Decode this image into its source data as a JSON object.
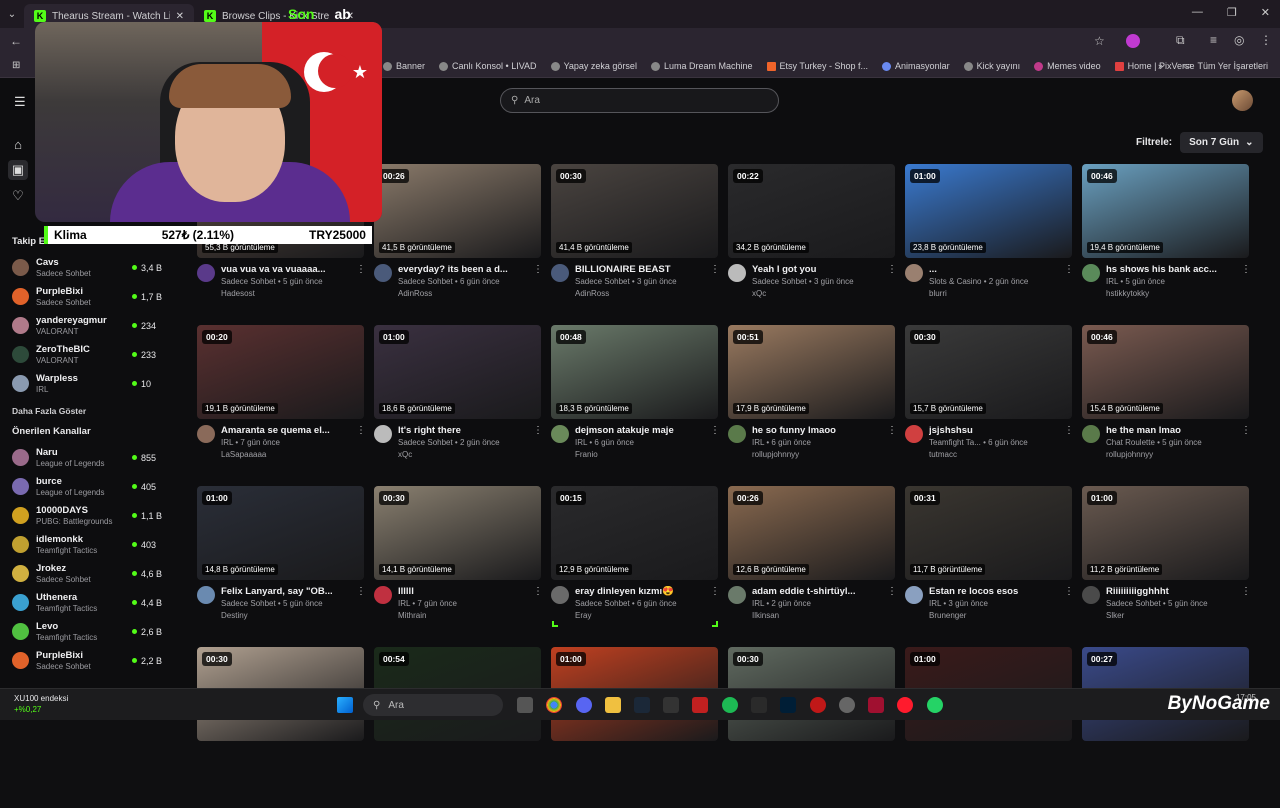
{
  "browser": {
    "tabs": [
      {
        "title": "Thearus Stream - Watch Live on",
        "active": true
      },
      {
        "title": "Browse Clips - Kick Stre",
        "active": false
      }
    ],
    "watermark": "Son",
    "watermark_tail": "ab",
    "bookmarks": [
      "Banner",
      "Canlı Konsol • LIVAD",
      "Yapay zeka görsel",
      "Luma Dream Machine",
      "Etsy Turkey - Shop f...",
      "Animasyonlar",
      "Kick yayını",
      "Memes video",
      "Home | PixVerse"
    ],
    "bookmarks_more": "»",
    "all_bookmarks": "Tüm Yer İşaretleri"
  },
  "search": {
    "placeholder": "Ara"
  },
  "filter": {
    "label": "Filtrele:",
    "value": "Son 7 Gün"
  },
  "overlay": {
    "ticker_name": "Klima",
    "ticker_value": "527₺ (2.11%)",
    "ticker_target": "TRY25000"
  },
  "sidebar": {
    "following_heading": "Takip E",
    "following": [
      {
        "name": "Cavs",
        "category": "Sadece Sohbet",
        "viewers": "3,4 B",
        "color": "#7a5a4a"
      },
      {
        "name": "PurpleBixi",
        "category": "Sadece Sohbet",
        "viewers": "1,7 B",
        "color": "#e0622a"
      },
      {
        "name": "yandereyagmur",
        "category": "VALORANT",
        "viewers": "234",
        "color": "#b07a8a"
      },
      {
        "name": "ZeroTheBIC",
        "category": "VALORANT",
        "viewers": "233",
        "color": "#2d4a3a"
      },
      {
        "name": "Warpless",
        "category": "IRL",
        "viewers": "10",
        "color": "#8a9ab0"
      }
    ],
    "show_more": "Daha Fazla Göster",
    "recommended_heading": "Önerilen Kanallar",
    "recommended": [
      {
        "name": "Naru",
        "category": "League of Legends",
        "viewers": "855",
        "color": "#9a6a8a"
      },
      {
        "name": "burce",
        "category": "League of Legends",
        "viewers": "405",
        "color": "#7a6ab0"
      },
      {
        "name": "10000DAYS",
        "category": "PUBG: Battlegrounds",
        "viewers": "1,1 B",
        "color": "#d0a020"
      },
      {
        "name": "idlemonkk",
        "category": "Teamfight Tactics",
        "viewers": "403",
        "color": "#c0a030"
      },
      {
        "name": "Jrokez",
        "category": "Sadece Sohbet",
        "viewers": "4,6 B",
        "color": "#d0b040"
      },
      {
        "name": "Uthenera",
        "category": "Teamfight Tactics",
        "viewers": "4,4 B",
        "color": "#3aa0d0"
      },
      {
        "name": "Levo",
        "category": "Teamfight Tactics",
        "viewers": "2,6 B",
        "color": "#50c040"
      },
      {
        "name": "PurpleBixi",
        "category": "Sadece Sohbet",
        "viewers": "2,2 B",
        "color": "#e0622a"
      }
    ]
  },
  "clips": [
    [
      {
        "duration": "00:26",
        "views": "55,3 B görüntüleme",
        "title": "vua vua va va vuaaaa...",
        "sub": "Sadece Sohbet • 5 gün önce",
        "channel": "Hadesost",
        "bg": "#5a4a40",
        "av": "#5a3a8a"
      },
      {
        "duration": "00:26",
        "views": "41,5 B görüntüleme",
        "title": "everyday? its been a d...",
        "sub": "Sadece Sohbet • 6 gün önce",
        "channel": "AdinRoss",
        "bg": "#8a7a6a",
        "av": "#4a5a7a"
      },
      {
        "duration": "00:30",
        "views": "41,4 B görüntüleme",
        "title": "BILLIONAIRE BEAST",
        "sub": "Sadece Sohbet • 3 gün önce",
        "channel": "AdinRoss",
        "bg": "#4a4440",
        "av": "#4a5a7a"
      },
      {
        "duration": "00:22",
        "views": "34,2 B görüntüleme",
        "title": "Yeah I got you",
        "sub": "Sadece Sohbet • 3 gün önce",
        "channel": "xQc",
        "bg": "#2a2a2c",
        "av": "#bbbbbb"
      },
      {
        "duration": "01:00",
        "views": "23,8 B görüntüleme",
        "title": "...",
        "sub": "Slots & Casino • 2 gün önce",
        "channel": "blurri",
        "bg": "#3a7ad0",
        "av": "#9a8070"
      },
      {
        "duration": "00:46",
        "views": "19,4 B görüntüleme",
        "title": "hs shows his bank acc...",
        "sub": "IRL • 5 gün önce",
        "channel": "hstikkytokky",
        "bg": "#6aa0c0",
        "av": "#5a8a5a"
      }
    ],
    [
      {
        "duration": "00:20",
        "views": "19,1 B görüntüleme",
        "title": "Amaranta se quema el...",
        "sub": "IRL • 7 gün önce",
        "channel": "LaSapaaaaa",
        "bg": "#5a3030",
        "av": "#8a6a5a"
      },
      {
        "duration": "01:00",
        "views": "18,6 B görüntüleme",
        "title": "It's right there",
        "sub": "Sadece Sohbet • 2 gün önce",
        "channel": "xQc",
        "bg": "#3a3040",
        "av": "#bbbbbb"
      },
      {
        "duration": "00:48",
        "views": "18,3 B görüntüleme",
        "title": "dejmson atakuje maje",
        "sub": "IRL • 6 gün önce",
        "channel": "Franio",
        "bg": "#6a7a6a",
        "av": "#6a8a5a"
      },
      {
        "duration": "00:51",
        "views": "17,9 B görüntüleme",
        "title": "he so funny lmaoo",
        "sub": "IRL • 6 gün önce",
        "channel": "rollupjohnnyy",
        "bg": "#9a7a60",
        "av": "#5a7a4a"
      },
      {
        "duration": "00:30",
        "views": "15,7 B görüntüleme",
        "title": "jsjshshsu",
        "sub": "Teamfight Ta... • 6 gün önce",
        "channel": "tutmacc",
        "bg": "#3a3a3a",
        "av": "#d04040"
      },
      {
        "duration": "00:46",
        "views": "15,4 B görüntüleme",
        "title": "he the man lmao",
        "sub": "Chat Roulette • 5 gün önce",
        "channel": "rollupjohnnyy",
        "bg": "#7a5a50",
        "av": "#5a7a4a"
      }
    ],
    [
      {
        "duration": "01:00",
        "views": "14,8 B görüntüleme",
        "title": "Felix Lanyard, say \"OB...",
        "sub": "Sadece Sohbet • 5 gün önce",
        "channel": "Destiny",
        "bg": "#2a2e38",
        "av": "#6a8ab0"
      },
      {
        "duration": "00:30",
        "views": "14,1 B görüntüleme",
        "title": "llllll",
        "sub": "IRL • 7 gün önce",
        "channel": "Mithrain",
        "bg": "#8a8070",
        "av": "#c03040"
      },
      {
        "duration": "00:15",
        "views": "12,9 B görüntüleme",
        "title": "eray dinleyen kızmı😍",
        "sub": "Sadece Sohbet • 6 gün önce",
        "channel": "Eray",
        "bg": "#2a2a2c",
        "av": "#6a6a6a"
      },
      {
        "duration": "00:26",
        "views": "12,6 B görüntüleme",
        "title": "adam eddie t-shirtüyl...",
        "sub": "IRL • 2 gün önce",
        "channel": "Ilkinsan",
        "bg": "#8a6a50",
        "av": "#6a7a6a"
      },
      {
        "duration": "00:31",
        "views": "11,7 B görüntüleme",
        "title": "Estan re locos esos",
        "sub": "IRL • 3 gün önce",
        "channel": "Brunenger",
        "bg": "#3a3630",
        "av": "#8aa0c0"
      },
      {
        "duration": "01:00",
        "views": "11,2 B görüntüleme",
        "title": "Riiiiiiiiigghhht",
        "sub": "Sadece Sohbet • 5 gün önce",
        "channel": "Slker",
        "bg": "#6a5a50",
        "av": "#4a4a4a"
      }
    ],
    [
      {
        "duration": "00:30",
        "bg": "#b0a090"
      },
      {
        "duration": "00:54",
        "bg": "#1a2a1a"
      },
      {
        "duration": "01:00",
        "bg": "#c04020"
      },
      {
        "duration": "00:30",
        "bg": "#606a60"
      },
      {
        "duration": "01:00",
        "bg": "#3a1a1a"
      },
      {
        "duration": "00:27",
        "bg": "#3a4a8a"
      }
    ]
  ],
  "taskbar": {
    "stock_name": "XU100 endeksi",
    "stock_change": "+%0,27",
    "search_placeholder": "Ara",
    "time": "17:05",
    "brand": "ByNoGame"
  }
}
